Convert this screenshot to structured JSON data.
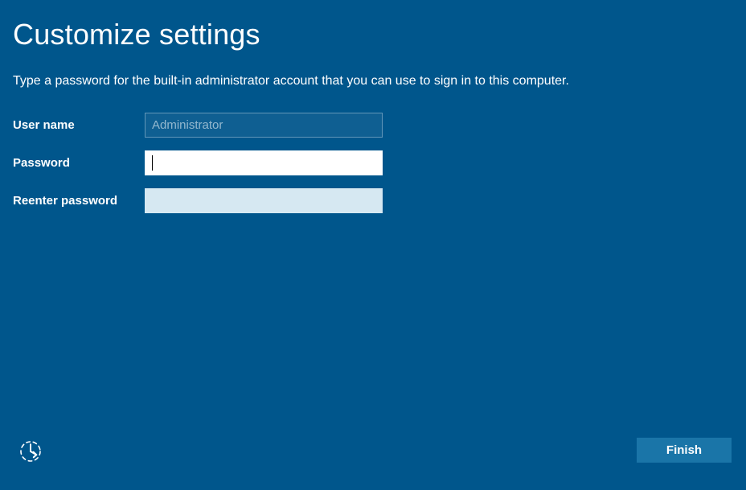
{
  "title": "Customize settings",
  "instruction": "Type a password for the built-in administrator account that you can use to sign in to this computer.",
  "form": {
    "username_label": "User name",
    "username_value": "Administrator",
    "password_label": "Password",
    "password_value": "",
    "reenter_label": "Reenter password",
    "reenter_value": ""
  },
  "buttons": {
    "finish_label": "Finish"
  },
  "icons": {
    "ease_of_access": "ease-of-access-icon"
  }
}
